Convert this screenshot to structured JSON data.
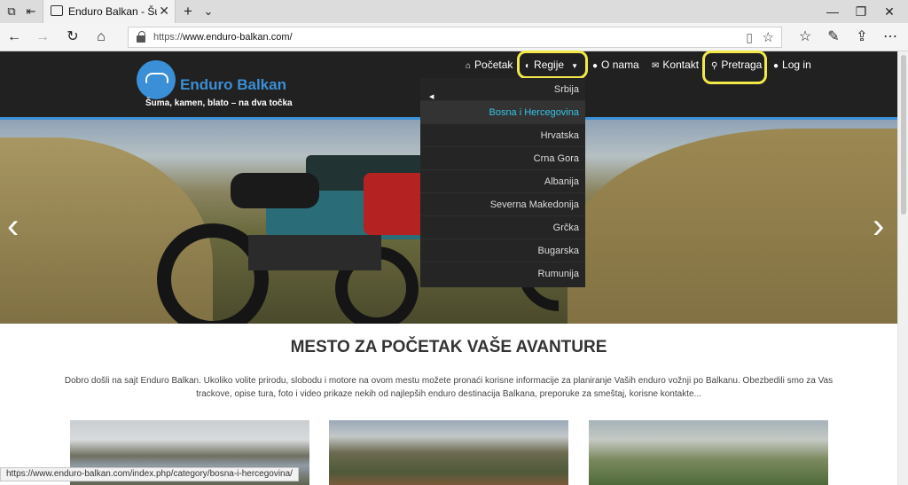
{
  "browser": {
    "tab_title": "Enduro Balkan - Šum",
    "url_scheme": "https://",
    "url_host": "www.enduro-balkan.com/",
    "status_url": "https://www.enduro-balkan.com/index.php/category/bosna-i-hercegovina/"
  },
  "site": {
    "logo_name": "Enduro Balkan",
    "tagline": "Šuma, kamen, blato – na dva točka",
    "accent_color": "#3a8fd6"
  },
  "menu": {
    "home": "Početak",
    "regions": "Regije",
    "about": "O nama",
    "contact": "Kontakt",
    "search": "Pretraga",
    "login": "Log in"
  },
  "regions_dropdown": [
    "Srbija",
    "Bosna i Hercegovina",
    "Hrvatska",
    "Crna Gora",
    "Albanija",
    "Severna Makedonija",
    "Grčka",
    "Bugarska",
    "Rumunija"
  ],
  "content": {
    "heading": "MESTO ZA POČETAK VAŠE AVANTURE",
    "intro_line1": "Dobro došli na sajt Enduro Balkan. Ukoliko volite prirodu, slobodu i motore na ovom mestu možete pronaći korisne informacije za planiranje Vaših enduro vožnji po Balkanu. Obezbedili smo za Vas",
    "intro_line2": "trackove, opise tura, foto i video prikaze nekih od najlepših enduro destinacija Balkana, preporuke za smeštaj, korisne kontakte..."
  }
}
